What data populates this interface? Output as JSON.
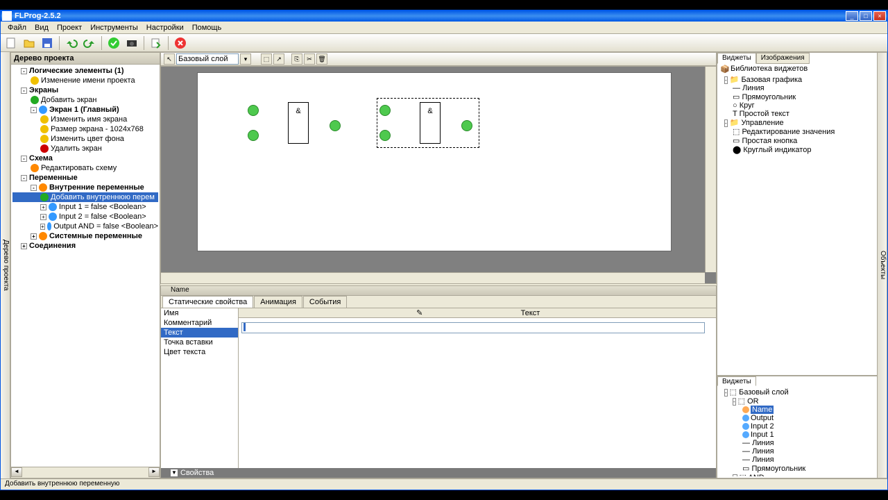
{
  "window": {
    "title": "FLProg-2.5.2"
  },
  "menu": {
    "file": "Файл",
    "view": "Вид",
    "project": "Проект",
    "tools": "Инструменты",
    "settings": "Настройки",
    "help": "Помощь"
  },
  "tree": {
    "title": "Дерево проекта",
    "logic_elements": "Логические элементы (1)",
    "change_name": "Изменение имени проекта",
    "screens": "Экраны",
    "add_screen": "Добавить экран",
    "screen1": "Экран 1 (Главный)",
    "change_screen_name": "Изменить имя экрана",
    "screen_size": "Размер экрана - 1024x768",
    "change_bg": "Изменить цвет фона",
    "delete_screen": "Удалить экран",
    "scheme": "Схема",
    "edit_scheme": "Редактировать схему",
    "variables": "Переменные",
    "internal_vars": "Внутренние переменные",
    "add_internal_var": "Добавить внутреннюю перем",
    "input1": "Input 1 = false <Boolean>",
    "input2": "Input 2 = false <Boolean>",
    "output_and": "Output AND = false <Boolean>",
    "system_vars": "Системные переменные",
    "connections": "Соединения"
  },
  "canvas": {
    "layer": "Базовый слой",
    "and": "&"
  },
  "props": {
    "name_header": "Name",
    "tab_static": "Статические свойства",
    "tab_anim": "Анимация",
    "tab_events": "События",
    "p_name": "Имя",
    "p_comment": "Комментарий",
    "p_text": "Текст",
    "p_insert": "Точка вставки",
    "p_color": "Цвет текста",
    "edit_header": "Текст",
    "footer": "Свойства"
  },
  "right": {
    "tab_widgets": "Виджеты",
    "tab_images": "Изображения",
    "lib_title": "Библиотека виджетов",
    "base_graphics": "Базовая графика",
    "line": "Линия",
    "rect": "Прямоугольник",
    "circle": "Круг",
    "simple_text": "Простой текст",
    "control": "Управление",
    "edit_value": "Редактирование значения",
    "simple_button": "Простая кнопка",
    "round_indicator": "Круглый индикатор",
    "bottom_tab": "Виджеты",
    "base_layer": "Базовый слой",
    "or": "OR",
    "name_node": "Name",
    "output": "Output",
    "input2": "Input 2",
    "input1": "Input 1",
    "line1": "Линия",
    "line2": "Линия",
    "line3": "Линия",
    "rect_node": "Прямоугольник",
    "and_node": "AND"
  },
  "side": {
    "left": "Дерево проекта",
    "right": "Объекты"
  },
  "status": "Добавить внутреннюю переменную"
}
